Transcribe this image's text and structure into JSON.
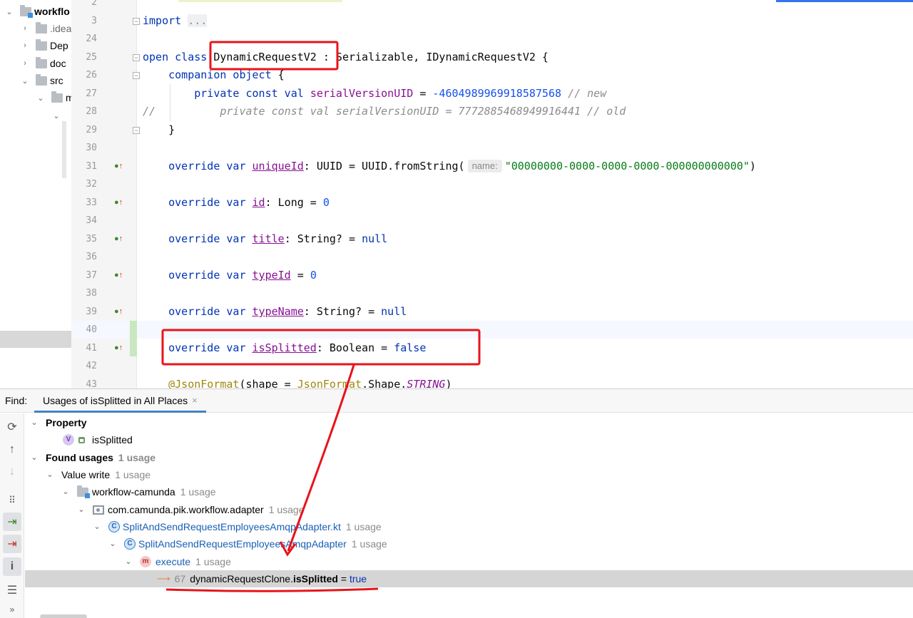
{
  "project_tree": {
    "items": [
      {
        "label": "workflo",
        "chevron": "⌄",
        "indent": 0,
        "bold": true,
        "module": true
      },
      {
        "label": ".idea",
        "chevron": "›",
        "indent": 1
      },
      {
        "label": "Dep",
        "chevron": "›",
        "indent": 1
      },
      {
        "label": "doc",
        "chevron": "›",
        "indent": 1
      },
      {
        "label": "src",
        "chevron": "⌄",
        "indent": 1
      },
      {
        "label": "m",
        "chevron": "⌄",
        "indent": 2
      },
      {
        "label": "",
        "chevron": "⌄",
        "indent": 3
      }
    ]
  },
  "editor": {
    "lines": [
      {
        "n": "2",
        "html": ""
      },
      {
        "n": "3",
        "html": "<span class='kw'>import</span> <span class='cmt' style='font-style:normal;background:#eef0f2'>...</span>",
        "fold": true
      },
      {
        "n": "24",
        "html": ""
      },
      {
        "n": "25",
        "html": "<span class='kw'>open class</span> DynamicRequestV2 : Serializable, IDynamicRequestV2 {",
        "fold": true
      },
      {
        "n": "26",
        "html": "    <span class='kw'>companion object</span> {",
        "fold": true
      },
      {
        "n": "27",
        "html": "        <span class='kw'>private const val</span> <span class='cnst' style='font-style:normal'>serialVersionUID</span> = <span class='num'>-4604989969918587568</span> <span class='cmt'>// new</span>"
      },
      {
        "n": "28",
        "html": "<span class='cmt'>//          private const val serialVersionUID = 7772885468949916441 // old</span>"
      },
      {
        "n": "29",
        "html": "    }",
        "fold": true
      },
      {
        "n": "30",
        "html": ""
      },
      {
        "n": "31",
        "html": "    <span class='kw'>override var</span> <span class='prop'>uniqueId</span>: UUID = UUID.fromString(<span class='hint'>name:</span><span class='str'>\"00000000-0000-0000-0000-000000000000\"</span>)",
        "impl": true
      },
      {
        "n": "32",
        "html": ""
      },
      {
        "n": "33",
        "html": "    <span class='kw'>override var</span> <span class='prop'>id</span>: Long = <span class='num'>0</span>",
        "impl": true
      },
      {
        "n": "34",
        "html": ""
      },
      {
        "n": "35",
        "html": "    <span class='kw'>override var</span> <span class='prop'>title</span>: String? = <span class='kw'>null</span>",
        "impl": true
      },
      {
        "n": "36",
        "html": ""
      },
      {
        "n": "37",
        "html": "    <span class='kw'>override var</span> <span class='prop'>typeId</span> = <span class='num'>0</span>",
        "impl": true
      },
      {
        "n": "38",
        "html": ""
      },
      {
        "n": "39",
        "html": "    <span class='kw'>override var</span> <span class='prop'>typeName</span>: String? = <span class='kw'>null</span>",
        "impl": true
      },
      {
        "n": "40",
        "html": ""
      },
      {
        "n": "41",
        "html": "    <span class='kw'>override var</span> <span class='prop'>isSplitted</span>: Boolean = <span class='kw'>false</span>",
        "impl": true
      },
      {
        "n": "42",
        "html": ""
      },
      {
        "n": "43",
        "html": "    <span class='ann'>@JsonFormat</span>(shape = <span class='ann'>JsonFormat</span>.Shape.<span class='cnst'>STRING</span>)"
      }
    ]
  },
  "find_panel": {
    "label": "Find:",
    "tab_title": "Usages of isSplitted in All Places",
    "tab_close": "×",
    "tree": {
      "property_header": "Property",
      "property_name": "isSplitted",
      "found_usages": "Found usages",
      "found_count": "1 usage",
      "value_write": "Value write",
      "value_write_count": "1 usage",
      "module": "workflow-camunda",
      "module_count": "1 usage",
      "package": "com.camunda.pik.workflow.adapter",
      "package_count": "1 usage",
      "file": "SplitAndSendRequestEmployeesAmqpAdapter.kt",
      "file_count": "1 usage",
      "class": "SplitAndSendRequestEmployeesAmqpAdapter",
      "class_count": "1 usage",
      "method": "execute",
      "method_count": "1 usage",
      "usage_line": "67",
      "usage_prefix": "dynamicRequestClone.",
      "usage_prop": "isSplitted",
      "usage_eq": " = ",
      "usage_value": "true"
    },
    "toolbar_icons": [
      "refresh-icon",
      "arrow-up-icon",
      "arrow-down-icon",
      "group-icon",
      "navigate-icon",
      "autoscroll-icon",
      "info-icon",
      "expand-icon",
      "more-icon"
    ]
  },
  "colors": {
    "annotation_red": "#e8141b",
    "keyword": "#0033b3",
    "property": "#871094"
  }
}
